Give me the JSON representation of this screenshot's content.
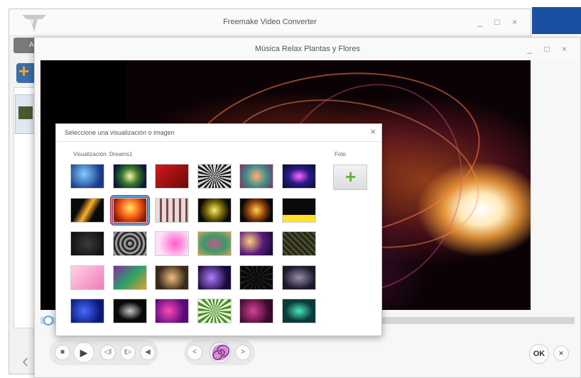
{
  "back_window": {
    "title": "Freemake Video Converter",
    "tab_label": "Ar",
    "controls": {
      "minimize": "_",
      "maximize": "□",
      "close": "×"
    }
  },
  "front_window": {
    "title": "Música Relax Plantas y Flores",
    "controls": {
      "minimize": "_",
      "maximize": "□",
      "close": "×"
    }
  },
  "dialog": {
    "title": "Seleccione una visualización o imagen",
    "close": "×",
    "visualization_label": "Visualización: Dreams1",
    "foto_label": "Foto",
    "selected_index": 7
  },
  "player": {
    "stop_icon": "■",
    "play_icon": "▶",
    "prev_icon": "◁I",
    "next_icon": "I▷",
    "volume_icon": "◀",
    "viz_prev_icon": "<",
    "viz_next_icon": ">",
    "ok_label": "OK",
    "cancel_icon": "×"
  },
  "colors": {
    "accent_blue": "#5aa7e0",
    "selection_red": "#c6283a",
    "add_green": "#63b33a"
  }
}
